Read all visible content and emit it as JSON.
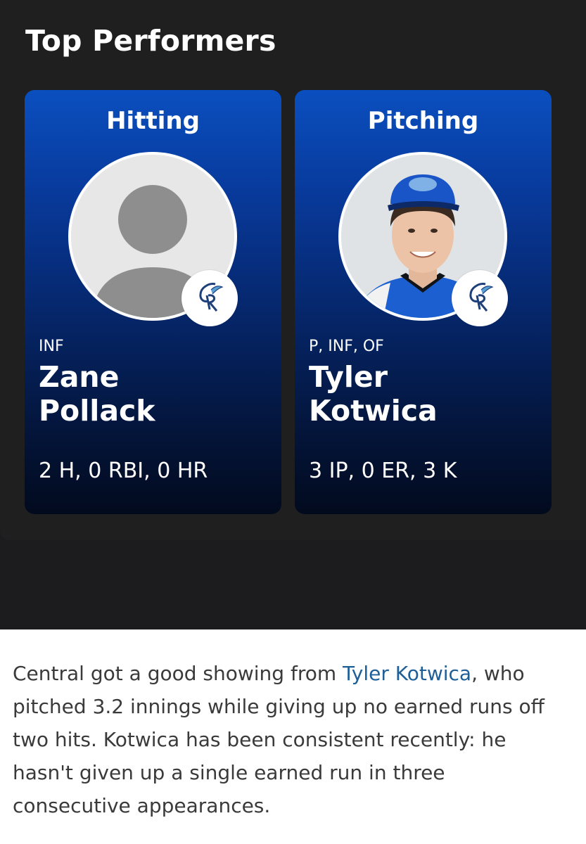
{
  "section": {
    "title": "Top Performers"
  },
  "cards": [
    {
      "category": "Hitting",
      "position": "INF",
      "first_name": "Zane",
      "last_name": "Pollack",
      "stats": "2 H, 0 RBI, 0 HR",
      "avatar_icon": "default-user-silhouette-icon",
      "team_logo_text": "CR"
    },
    {
      "category": "Pitching",
      "position": "P, INF, OF",
      "first_name": "Tyler",
      "last_name": "Kotwica",
      "stats": "3 IP, 0 ER, 3 K",
      "avatar_icon": "player-photo",
      "team_logo_text": "CR"
    }
  ],
  "article": {
    "before_link": "Central got a good showing from ",
    "link_text": "Tyler Kotwica",
    "after_link": ", who pitched 3.2 innings while giving up no earned runs off two hits. Kotwica has been consistent recently: he hasn't given up a single earned run in three consecutive appearances."
  },
  "colors": {
    "panel_bg": "#1f1f1f",
    "card_top": "#0a4fbf",
    "card_bottom": "#020a1d",
    "link": "#1f5f98"
  }
}
